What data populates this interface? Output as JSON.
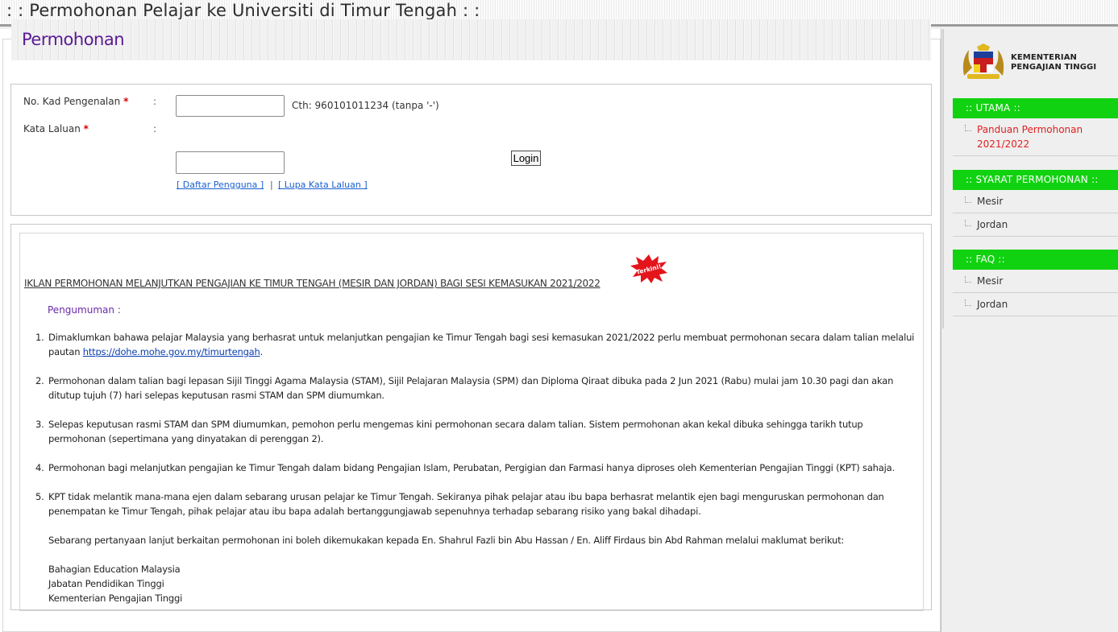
{
  "header": {
    "title": ": : Permohonan Pelajar ke Universiti di Timur Tengah : :"
  },
  "main": {
    "heading": "Permohonan",
    "login": {
      "ic_label": "No. Kad Pengenalan",
      "password_label": "Kata Laluan",
      "required_mark": "*",
      "colon": ":",
      "ic_value": "",
      "password_value": "",
      "ic_hint": "Cth: 960101011234 (tanpa '-')",
      "register_link": "[ Daftar Pengguna ]",
      "separator": "|",
      "forgot_link": "[ Lupa Kata Laluan ]",
      "login_button": "Login"
    },
    "announcement": {
      "title": "IKLAN PERMOHONAN MELANJUTKAN PENGAJIAN KE TIMUR TENGAH (MESIR DAN JORDAN) BAGI SESI KEMASUKAN 2021/2022",
      "badge": "Terkini!",
      "notice_label": "Pengumuman :",
      "items": [
        {
          "num": "1.",
          "text_before": "Dimaklumkan bahawa pelajar Malaysia yang berhasrat untuk melanjutkan pengajian ke Timur Tengah bagi sesi kemasukan 2021/2022 perlu membuat permohonan secara dalam talian melalui pautan ",
          "link": "https://dohe.mohe.gov.my/timurtengah",
          "text_after": "."
        },
        {
          "num": "2.",
          "text": "Permohonan dalam talian bagi lepasan Sijil Tinggi Agama Malaysia (STAM), Sijil Pelajaran Malaysia (SPM) dan Diploma Qiraat dibuka pada 2 Jun 2021 (Rabu) mulai jam 10.30 pagi dan akan ditutup tujuh (7) hari selepas keputusan rasmi STAM dan SPM diumumkan."
        },
        {
          "num": "3.",
          "text": "Selepas keputusan rasmi STAM dan SPM diumumkan, pemohon perlu mengemas kini permohonan secara dalam talian. Sistem permohonan akan kekal dibuka sehingga tarikh tutup permohonan (sepertimana yang dinyatakan di perenggan 2)."
        },
        {
          "num": "4.",
          "text": "Permohonan bagi melanjutkan pengajian ke Timur Tengah dalam bidang Pengajian Islam, Perubatan, Pergigian dan Farmasi hanya diproses oleh Kementerian Pengajian Tinggi (KPT) sahaja."
        },
        {
          "num": "5.",
          "text": "KPT tidak melantik mana-mana ejen dalam sebarang urusan pelajar ke Timur Tengah. Sekiranya pihak pelajar atau ibu bapa berhasrat melantik ejen bagi menguruskan permohonan dan penempatan ke Timur Tengah, pihak pelajar atau ibu bapa adalah bertanggungjawab sepenuhnya terhadap sebarang risiko yang bakal dihadapi."
        }
      ],
      "contact_intro": "Sebarang pertanyaan lanjut berkaitan permohonan ini boleh dikemukakan kepada En. Shahrul Fazli bin Abu Hassan / En. Aliff Firdaus bin Abd Rahman melalui maklumat berikut:",
      "address_lines": [
        "Bahagian Education Malaysia",
        "Jabatan Pendidikan Tinggi",
        "Kementerian Pengajian Tinggi"
      ]
    }
  },
  "sidebar": {
    "ministry_line1": "KEMENTERIAN",
    "ministry_line2": "PENGAJIAN TINGGI",
    "sections": [
      {
        "title": ":: UTAMA ::",
        "items": [
          "Panduan Permohonan 2021/2022"
        ]
      },
      {
        "title": ":: SYARAT PERMOHONAN ::",
        "items": [
          "Mesir",
          "Jordan"
        ]
      },
      {
        "title": ":: FAQ ::",
        "items": [
          "Mesir",
          "Jordan"
        ]
      }
    ]
  },
  "colors": {
    "accent_green": "#10d210",
    "heading_purple": "#5b1a95",
    "link_blue": "#1a5fd0",
    "required_red": "#d40000"
  }
}
